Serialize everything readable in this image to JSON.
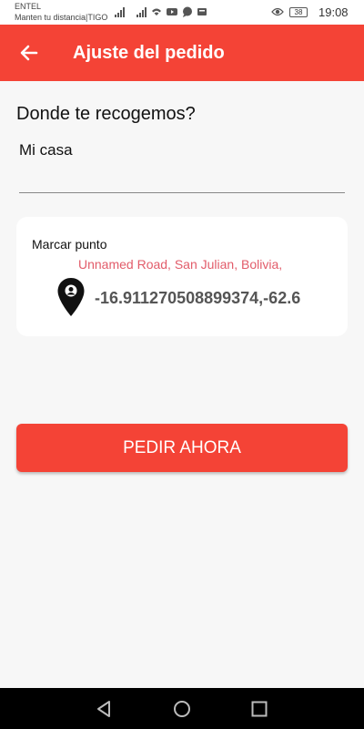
{
  "status_bar": {
    "carrier_line1": "ENTEL",
    "carrier_line2": "Manten tu distancia|TIGO",
    "battery": "38",
    "time": "19:08"
  },
  "app_bar": {
    "title": "Ajuste del pedido",
    "color": "#f44336"
  },
  "form": {
    "question": "Donde te recogemos?",
    "place_value": "Mi casa"
  },
  "location_card": {
    "label": "Marcar punto",
    "address": "Unnamed Road, San Julian, Bolivia,",
    "coordinates": "-16.911270508899374,-62.6"
  },
  "order_button": {
    "label": "PEDIR AHORA"
  },
  "icons": {
    "back": "arrow-back-icon",
    "pin": "map-pin-icon",
    "nav_back": "triangle-back-icon",
    "nav_home": "circle-home-icon",
    "nav_recents": "square-recents-icon"
  }
}
